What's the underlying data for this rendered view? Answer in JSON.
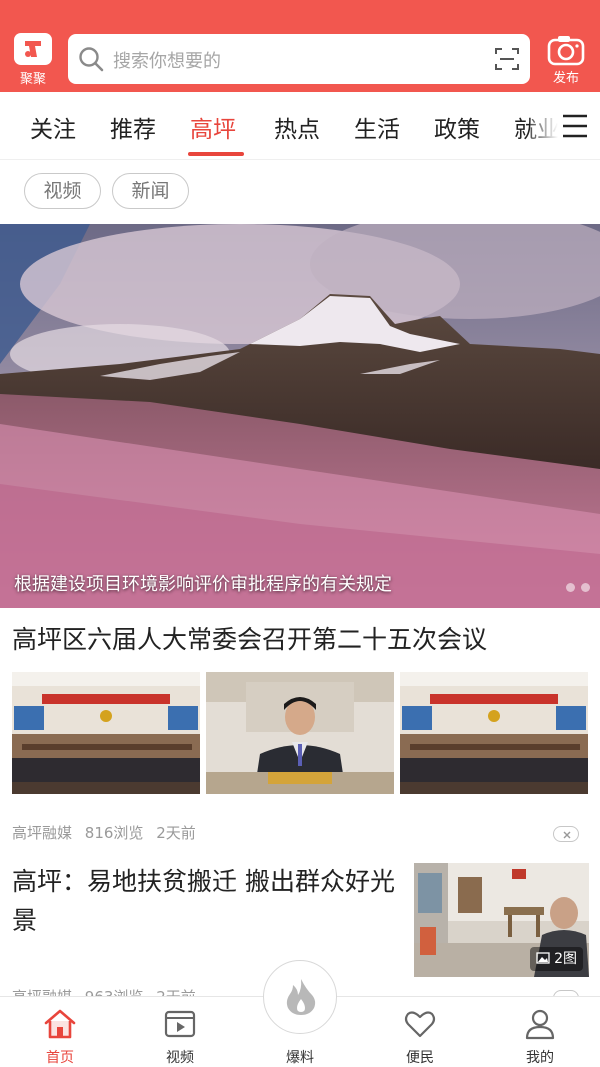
{
  "header": {
    "logo_label": "聚聚",
    "search_placeholder": "搜索你想要的",
    "publish_label": "发布",
    "brand_color": "#f2574f"
  },
  "tabs": {
    "items": [
      {
        "label": "关注",
        "active": false
      },
      {
        "label": "推荐",
        "active": false
      },
      {
        "label": "高坪",
        "active": true
      },
      {
        "label": "热点",
        "active": false
      },
      {
        "label": "生活",
        "active": false
      },
      {
        "label": "政策",
        "active": false
      },
      {
        "label": "就业",
        "active": false
      }
    ],
    "active_color": "#e8453c"
  },
  "filters": [
    {
      "label": "视频"
    },
    {
      "label": "新闻"
    }
  ],
  "hero": {
    "caption": "根据建设项目环境影响评价审批程序的有关规定",
    "dots": 2
  },
  "articles": [
    {
      "title": "高坪区六届人大常委会召开第二十五次会议",
      "source": "高坪融媒",
      "views": "816浏览",
      "time": "2天前"
    },
    {
      "title": "高坪：易地扶贫搬迁  搬出群众好光景",
      "image_count": "2图",
      "source": "高坪融媒",
      "views": "963浏览",
      "time": "2天前"
    }
  ],
  "bottom_nav": {
    "items": [
      {
        "label": "首页",
        "icon": "home-icon",
        "active": true
      },
      {
        "label": "视频",
        "icon": "video-icon",
        "active": false
      },
      {
        "label": "爆料",
        "icon": "fire-icon",
        "active": false
      },
      {
        "label": "便民",
        "icon": "heart-icon",
        "active": false
      },
      {
        "label": "我的",
        "icon": "user-icon",
        "active": false
      }
    ]
  }
}
